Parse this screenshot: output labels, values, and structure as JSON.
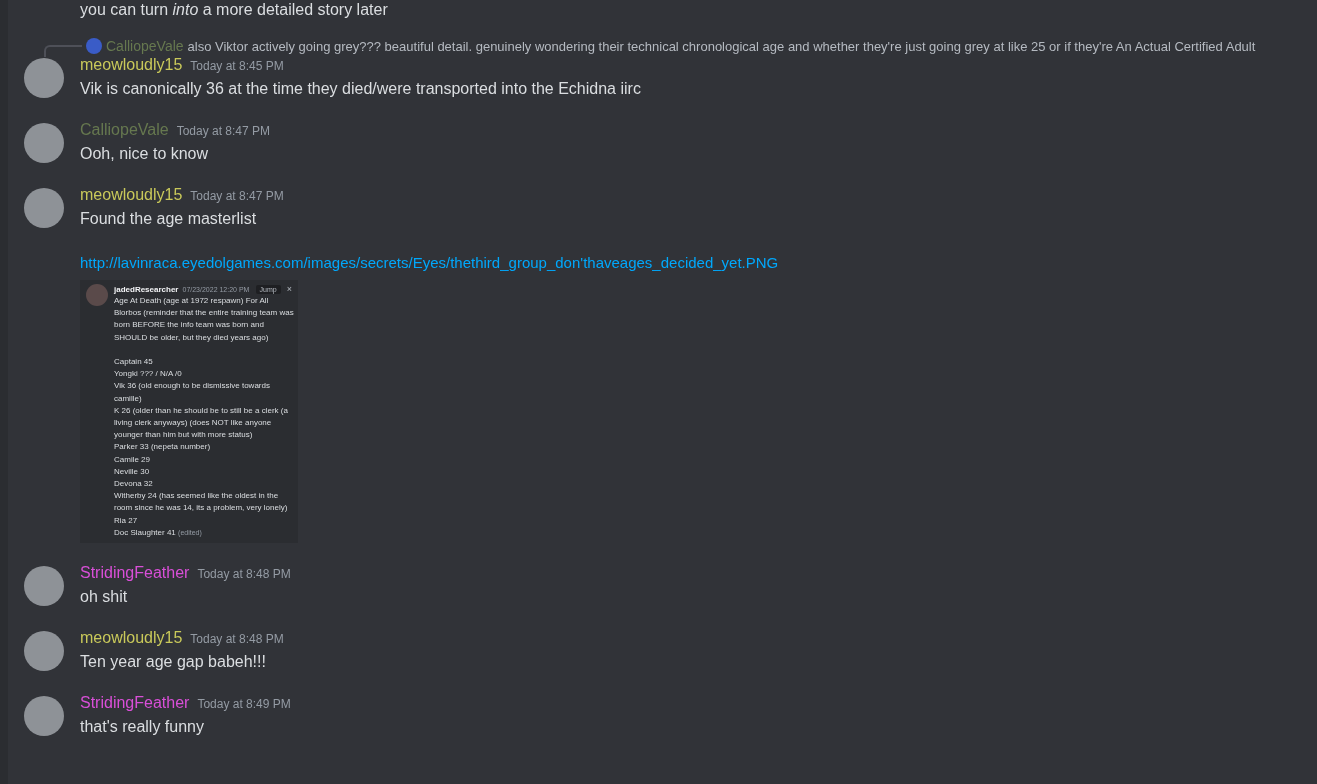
{
  "partial_top_message": {
    "text": "you can turn *into* a more detailed story later"
  },
  "messages": [
    {
      "author": "meowloudly15",
      "color": "#c9c95a",
      "timestamp": "Today at 8:45 PM",
      "reply": {
        "author": "CalliopeVale",
        "color": "#66784f",
        "text": "also Viktor actively going grey??? beautiful detail. genuinely wondering their technical chronological age and whether they're just going grey at like 25 or if they're An Actual Certified Adult"
      },
      "content": [
        {
          "kind": "text",
          "text": "Vik is canonically 36 at the time they died/were transported into the Echidna iirc"
        }
      ]
    },
    {
      "author": "CalliopeVale",
      "color": "#66784f",
      "timestamp": "Today at 8:47 PM",
      "content": [
        {
          "kind": "text",
          "text": "Ooh, nice to know"
        }
      ]
    },
    {
      "author": "meowloudly15",
      "color": "#c9c95a",
      "timestamp": "Today at 8:47 PM",
      "content": [
        {
          "kind": "text",
          "text": "Found the age masterlist"
        },
        {
          "kind": "link",
          "text": "http://lavinraca.eyedolgames.com/images/secrets/Eyes/thethird_group_don'thaveages_decided_yet.PNG"
        },
        {
          "kind": "screenshot",
          "author": "jadedResearcher",
          "timestamp": "07/23/2022 12:20 PM",
          "jump": "Jump",
          "close": "×",
          "edited": "(edited)",
          "intro": "Age At Death (age at 1972 respawn) For All Blorbos (reminder that the entire training team was born BEFORE the info team was born and SHOULD be older, but they died years ago)",
          "lines": [
            "Captain 45",
            "Yongki ??? / N/A  /0",
            "Vik 36 (old enough to be dismissive towards camille)",
            "K 26  (older than he should be to still be a clerk (a living clerk anyways) (does NOT like anyone younger than him but with more status)",
            "Parker 33 (nepeta number)",
            "Camile 29",
            "Neville 30",
            "Devona 32",
            "Witherby 24  (has seemed like the oldest in the room since he was 14, its a problem, very lonely)",
            "Ria  27",
            "Doc Slaughter 41"
          ]
        }
      ]
    },
    {
      "author": "StridingFeather",
      "color": "#d94fd8",
      "timestamp": "Today at 8:48 PM",
      "content": [
        {
          "kind": "text",
          "text": "oh shit"
        }
      ]
    },
    {
      "author": "meowloudly15",
      "color": "#c9c95a",
      "timestamp": "Today at 8:48 PM",
      "content": [
        {
          "kind": "text",
          "text": "Ten year age gap babeh!!!"
        }
      ]
    },
    {
      "author": "StridingFeather",
      "color": "#d94fd8",
      "timestamp": "Today at 8:49 PM",
      "content": [
        {
          "kind": "text",
          "text": "that's really funny"
        }
      ]
    }
  ]
}
